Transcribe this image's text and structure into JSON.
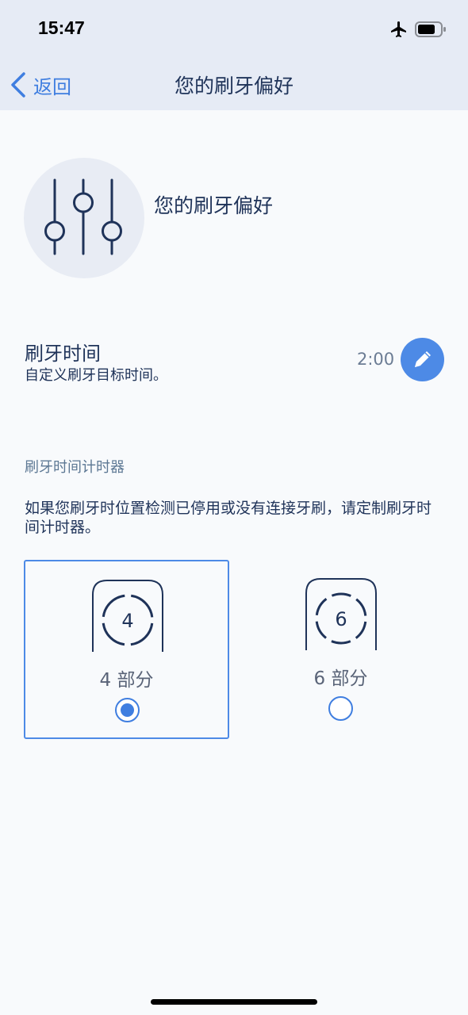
{
  "status_bar": {
    "time": "15:47",
    "icons": [
      "airplane-icon",
      "battery-icon"
    ]
  },
  "nav": {
    "back_label": "返回",
    "title": "您的刷牙偏好"
  },
  "hero": {
    "icon": "sliders-icon",
    "title": "您的刷牙偏好"
  },
  "brushing_time": {
    "title": "刷牙时间",
    "subtitle": "自定义刷牙目标时间。",
    "value": "2:00",
    "edit_icon": "pencil-icon"
  },
  "timer": {
    "section_title": "刷牙时间计时器",
    "description": "如果您刷牙时位置检测已停用或没有连接牙刷，请定制刷牙时间计时器。",
    "options": [
      {
        "number": "4",
        "label": "4 部分",
        "selected": true
      },
      {
        "number": "6",
        "label": "6 部分",
        "selected": false
      }
    ]
  },
  "colors": {
    "accent": "#4d8ae6",
    "navy": "#1f3359",
    "header_bg": "#e6ebf5",
    "page_bg": "#f8fafc"
  }
}
